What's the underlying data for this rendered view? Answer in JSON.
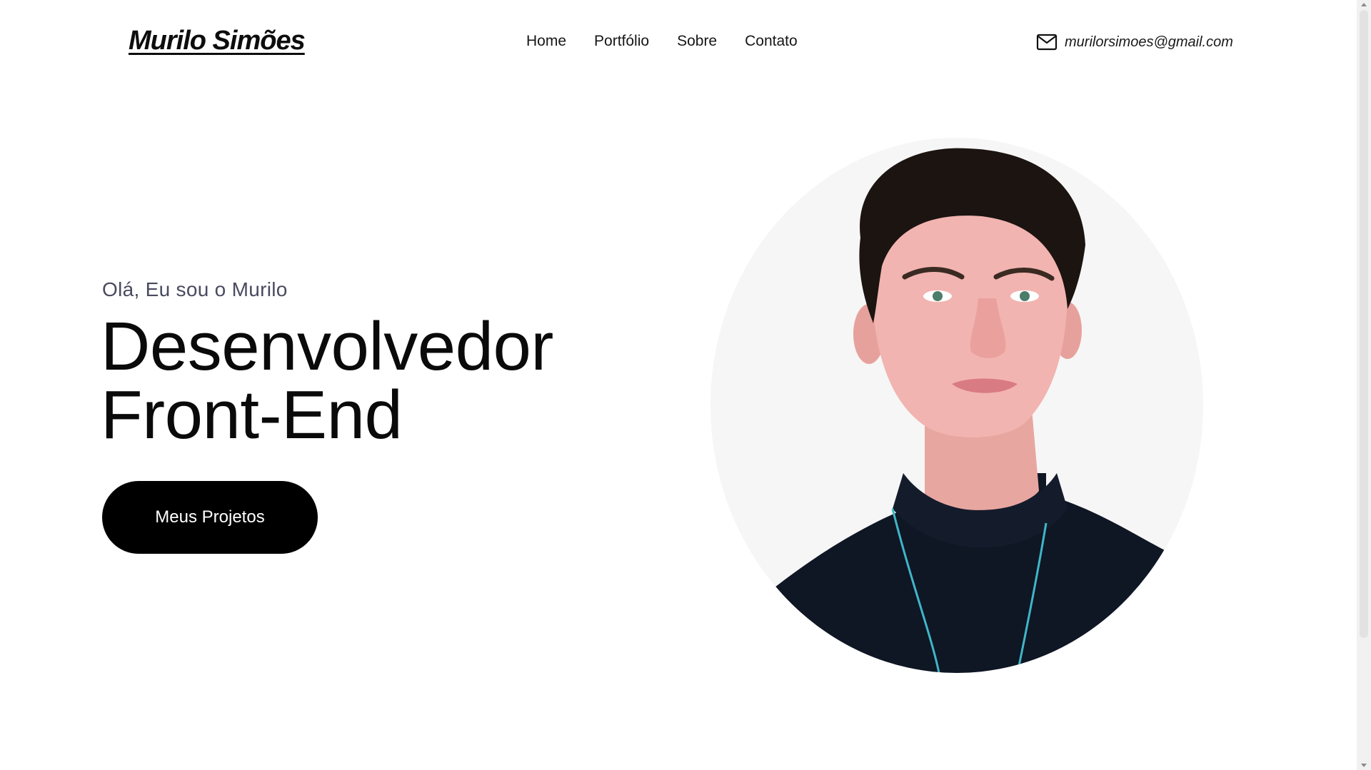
{
  "header": {
    "logo": "Murilo Simões",
    "nav": [
      {
        "label": "Home"
      },
      {
        "label": "Portfólio"
      },
      {
        "label": "Sobre"
      },
      {
        "label": "Contato"
      }
    ],
    "email": "murilorsimoes@gmail.com",
    "email_icon": "mail-icon"
  },
  "hero": {
    "greeting": "Olá, Eu sou o Murilo",
    "headline_line1": "Desenvolvedor",
    "headline_line2": "Front-End",
    "cta_label": "Meus Projetos",
    "portrait_image": "profile-photo"
  },
  "colors": {
    "background": "#ffffff",
    "text": "#111111",
    "greeting": "#4a4a60",
    "button_bg": "#000000",
    "button_text": "#ffffff",
    "portrait_bg": "#f6f6f6"
  }
}
